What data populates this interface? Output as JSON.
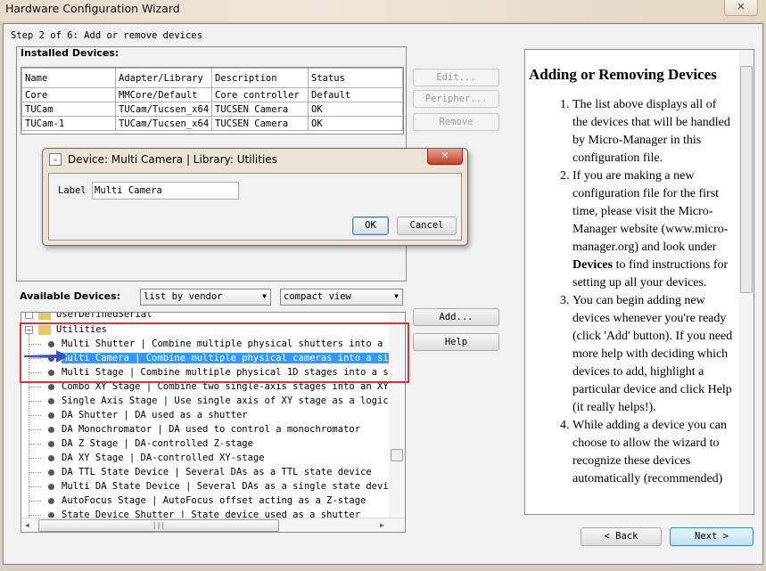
{
  "window": {
    "title": "Hardware Configuration Wizard",
    "close_label": "✕"
  },
  "step": "Step 2 of 6: Add or remove devices",
  "installed": {
    "heading": "Installed Devices:",
    "columns": [
      "Name",
      "Adapter/Library",
      "Description",
      "Status"
    ],
    "rows": [
      [
        "Core",
        "MMCore/Default",
        "Core controller",
        "Default"
      ],
      [
        "TUCam",
        "TUCam/Tucsen_x64",
        "TUCSEN Camera",
        "OK"
      ],
      [
        "TUCam-1",
        "TUCam/Tucsen_x64",
        "TUCSEN Camera",
        "OK"
      ]
    ],
    "buttons": {
      "edit": "Edit...",
      "peripheral": "Peripher...",
      "remove": "Remove"
    }
  },
  "dialog": {
    "title": "Device: Multi Camera | Library: Utilities",
    "label": "Label",
    "value": "Multi Camera",
    "ok": "OK",
    "cancel": "Cancel"
  },
  "available": {
    "heading": "Available Devices:",
    "list_mode": "list by vendor",
    "view_mode": "compact view",
    "add": "Add...",
    "help": "Help",
    "tree": {
      "partial_folder": "UserDefinedSerial",
      "folder": "Utilities",
      "items": [
        "Multi Shutter | Combine multiple physical shutters into a s",
        "Multi Camera | Combine multiple physical cameras into a sin",
        "Multi Stage | Combine multiple physical 1D stages into a si",
        "Combo XY Stage | Combine two single-axis stages into an XY",
        "Single Axis Stage | Use single axis of XY stage as a logica",
        "DA Shutter | DA used as a shutter",
        "DA Monochromator | DA used to control a monochromator",
        "DA Z Stage | DA-controlled Z-stage",
        "DA XY Stage | DA-controlled XY-stage",
        "DA TTL State Device | Several DAs as a TTL state device",
        "Multi DA State Device | Several DAs as a single state devic",
        "AutoFocus Stage | AutoFocus offset acting as a Z-stage",
        "State Device Shutter | State device used as a shutter"
      ],
      "selected_index": 1
    },
    "highlight_color": "#e03030",
    "selection_color": "#3399ff"
  },
  "help_panel": {
    "title": "Adding or Removing Devices",
    "items": [
      [
        "The list above displays all of the devices that will be handled by Micro-Manager in this configuration file."
      ],
      [
        "If you are making a new configuration file for the first time, please visit the Micro-Manager website (www.micro-manager.org) and look under ",
        "Devices",
        " to find instructions for setting up all your devices."
      ],
      [
        "You can begin adding new devices whenever you're ready (click 'Add' button). If you need more help with deciding which devices to add, highlight a particular device and click Help (it really helps!)."
      ],
      [
        "While adding a device you can choose to allow the wizard to recognize these devices automatically (recommended)"
      ]
    ]
  },
  "nav": {
    "back": "< Back",
    "next": "Next >"
  }
}
